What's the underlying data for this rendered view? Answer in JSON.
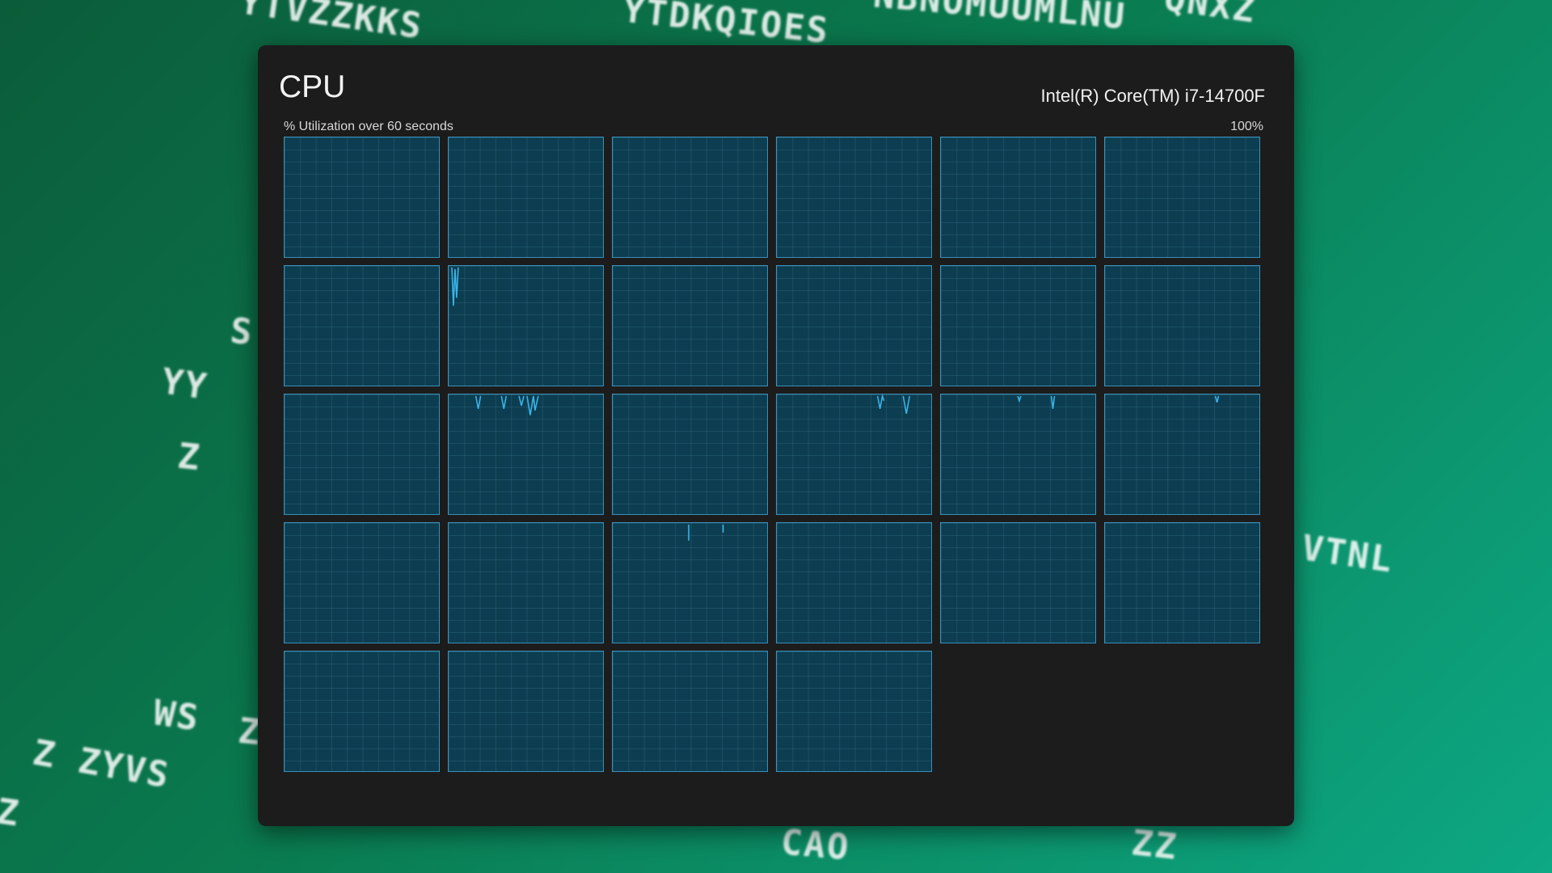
{
  "background": {
    "words": [
      "YTVZZKKS",
      "YTDKQIOES",
      "NBNOMUUMLNU",
      "QNXZ",
      "S",
      "YY",
      "Z",
      "WS",
      "Z",
      "Z ZYVS",
      "Z",
      "VTNL",
      "CAO",
      "ZZ"
    ]
  },
  "window": {
    "title": "CPU",
    "model": "Intel(R) Core(TM) i7-14700F",
    "subtitle": "% Utilization over 60 seconds",
    "max_label": "100%"
  },
  "cpu_graphs": {
    "columns": 6,
    "count": 28,
    "line_color": "#3ab4e8",
    "activity": {
      "7": "high spike near start",
      "13": "several small spikes",
      "15": "two small spikes",
      "16": "small spikes",
      "17": "tiny spike",
      "20": "two tiny spikes"
    }
  }
}
